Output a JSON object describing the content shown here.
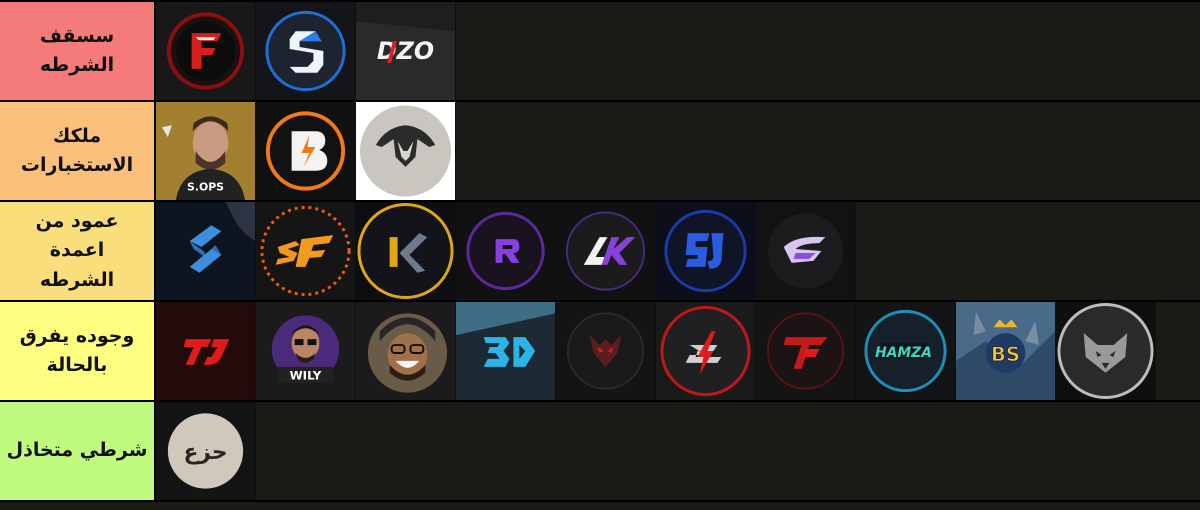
{
  "tiers": [
    {
      "label": "سسقف الشرطه",
      "color": "#f57b7b",
      "items": [
        "f-logo",
        "s-blue-logo",
        "dzo-logo"
      ]
    },
    {
      "label": "ملكك\nالاستخبارات",
      "color": "#fbbf7c",
      "items": [
        "s-ops-avatar",
        "b-orange-logo",
        "helmet-logo"
      ]
    },
    {
      "label": "عمود من اعمدة\nالشرطه",
      "color": "#fbde7c",
      "items": [
        "blue-s-logo",
        "sf-orange-logo",
        "k-yellow-logo",
        "r-purple-logo",
        "ak-purple-logo",
        "sj-blue-logo",
        "g-purple-logo"
      ]
    },
    {
      "label": "وجوده يفرق\nبالحالة",
      "color": "#fdfe7f",
      "items": [
        "tj-red-logo",
        "wily-avatar",
        "laughing-avatar",
        "3d-cyan-logo",
        "skull-red-logo",
        "s-red-logo",
        "t-red-logo",
        "hamza-logo",
        "bs-gold-logo",
        "wolf-grey-logo"
      ]
    },
    {
      "label": "شرطي متخاذل",
      "color": "#c0fb7f",
      "items": [
        "zh-stamp-logo"
      ]
    }
  ],
  "logo_text": {
    "dzo": "DZO",
    "s_ops": "S.OPS",
    "wily": "WILY",
    "hamza": "HAMZA",
    "bs": "BS",
    "zh": "حزع"
  }
}
